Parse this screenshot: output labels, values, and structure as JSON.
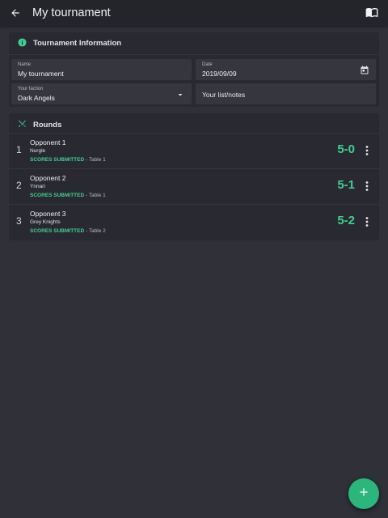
{
  "appbar": {
    "title": "My tournament",
    "back_icon": "arrow-left-icon",
    "book_icon": "open-book-icon"
  },
  "info": {
    "header": "Tournament Information",
    "icon": "info-circle-icon",
    "name_label": "Name",
    "name_value": "My tournament",
    "date_label": "Date",
    "date_value": "2019/09/09",
    "faction_label": "Your faction",
    "faction_value": "Dark Angels",
    "notes_placeholder": "Your list/notes"
  },
  "rounds": {
    "header": "Rounds",
    "icon": "crossed-swords-icon",
    "items": [
      {
        "num": "1",
        "opponent": "Opponent 1",
        "faction": "Nurgle",
        "status": "SCORES SUBMITTED",
        "table": " - Table 1",
        "score": "5-0"
      },
      {
        "num": "2",
        "opponent": "Opponent 2",
        "faction": "Ynnari",
        "status": "SCORES SUBMITTED",
        "table": " - Table 1",
        "score": "5-1"
      },
      {
        "num": "3",
        "opponent": "Opponent 3",
        "faction": "Grey Knights",
        "status": "SCORES SUBMITTED",
        "table": " - Table 2",
        "score": "5-2"
      }
    ]
  },
  "colors": {
    "accent": "#3ecf8e",
    "fab": "#2bb67c",
    "background": "#2f3038",
    "appbar": "#24252b"
  }
}
